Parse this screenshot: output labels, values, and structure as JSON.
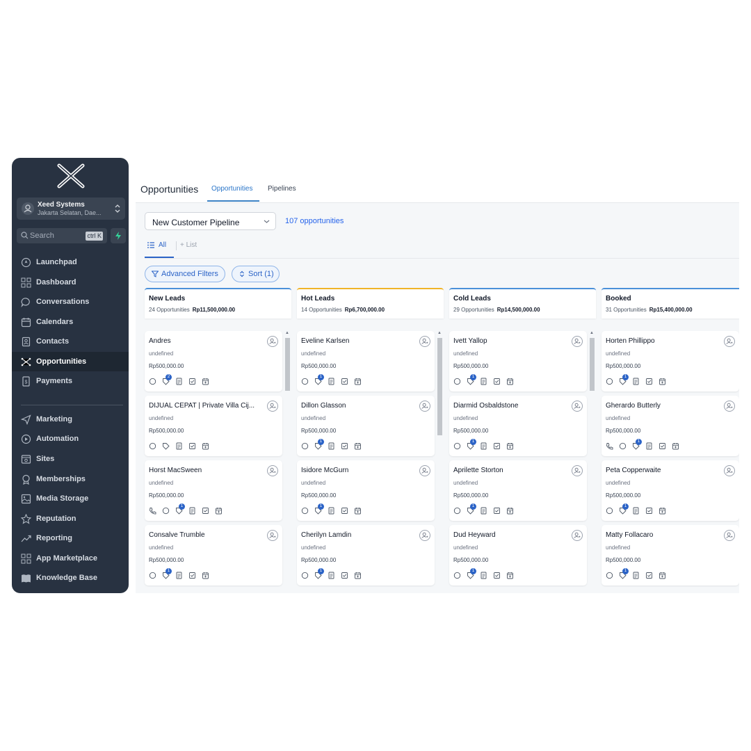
{
  "sidebar": {
    "account_name": "Xeed Systems",
    "account_location": "Jakarta Selatan, Dae...",
    "search_placeholder": "Search",
    "search_shortcut": "ctrl K",
    "items": [
      {
        "label": "Launchpad",
        "icon": "rocket-icon"
      },
      {
        "label": "Dashboard",
        "icon": "grid-icon"
      },
      {
        "label": "Conversations",
        "icon": "chat-icon"
      },
      {
        "label": "Calendars",
        "icon": "calendar-icon"
      },
      {
        "label": "Contacts",
        "icon": "contacts-icon"
      },
      {
        "label": "Opportunities",
        "icon": "opportunities-icon",
        "active": true
      },
      {
        "label": "Payments",
        "icon": "payments-icon"
      },
      {
        "label": "Marketing",
        "icon": "send-icon"
      },
      {
        "label": "Automation",
        "icon": "automation-icon"
      },
      {
        "label": "Sites",
        "icon": "sites-icon"
      },
      {
        "label": "Memberships",
        "icon": "badge-icon"
      },
      {
        "label": "Media Storage",
        "icon": "image-icon"
      },
      {
        "label": "Reputation",
        "icon": "star-icon"
      },
      {
        "label": "Reporting",
        "icon": "trend-icon"
      },
      {
        "label": "App Marketplace",
        "icon": "apps-icon"
      },
      {
        "label": "Knowledge Base",
        "icon": "book-icon"
      }
    ]
  },
  "header": {
    "title": "Opportunities",
    "tabs": [
      "Opportunities",
      "Pipelines"
    ]
  },
  "toolbar": {
    "pipeline": "New Customer Pipeline",
    "opportunity_count": "107 opportunities",
    "view_all": "All",
    "view_list": "+ List",
    "advanced_filters": "Advanced Filters",
    "sort": "Sort (1)"
  },
  "columns": [
    {
      "title": "New Leads",
      "count": "24 Opportunities",
      "total": "Rp11,500,000.00",
      "cards": [
        {
          "name": "Andres",
          "source": "undefined",
          "value": "Rp500,000.00",
          "badge": "2",
          "phone": false
        },
        {
          "name": "DIJUAL CEPAT | Private Villa Cij...",
          "source": "undefined",
          "value": "Rp500,000.00",
          "badge": "",
          "phone": false
        },
        {
          "name": "Horst MacSween",
          "source": "undefined",
          "value": "Rp500,000.00",
          "badge": "1",
          "phone": true
        },
        {
          "name": "Consalve Trumble",
          "source": "undefined",
          "value": "Rp500,000.00",
          "badge": "1",
          "phone": false
        }
      ]
    },
    {
      "title": "Hot Leads",
      "count": "14 Opportunities",
      "total": "Rp6,700,000.00",
      "cards": [
        {
          "name": "Eveline Karlsen",
          "source": "undefined",
          "value": "Rp500,000.00",
          "badge": "1",
          "phone": false
        },
        {
          "name": "Dillon Glasson",
          "source": "undefined",
          "value": "Rp500,000.00",
          "badge": "1",
          "phone": false
        },
        {
          "name": "Isidore McGurn",
          "source": "undefined",
          "value": "Rp500,000.00",
          "badge": "1",
          "phone": false
        },
        {
          "name": "Cherilyn Lamdin",
          "source": "undefined",
          "value": "Rp500,000.00",
          "badge": "1",
          "phone": false
        }
      ]
    },
    {
      "title": "Cold Leads",
      "count": "29 Opportunities",
      "total": "Rp14,500,000.00",
      "cards": [
        {
          "name": "Ivett Yallop",
          "source": "undefined",
          "value": "Rp500,000.00",
          "badge": "1",
          "phone": false
        },
        {
          "name": "Diarmid Osbaldstone",
          "source": "undefined",
          "value": "Rp500,000.00",
          "badge": "1",
          "phone": false
        },
        {
          "name": "Aprilette Storton",
          "source": "undefined",
          "value": "Rp500,000.00",
          "badge": "1",
          "phone": false
        },
        {
          "name": "Dud Heyward",
          "source": "undefined",
          "value": "Rp500,000.00",
          "badge": "1",
          "phone": false
        }
      ]
    },
    {
      "title": "Booked",
      "count": "31 Opportunities",
      "total": "Rp15,400,000.00",
      "cards": [
        {
          "name": "Horten Phillippo",
          "source": "undefined",
          "value": "Rp500,000.00",
          "badge": "1",
          "phone": false
        },
        {
          "name": "Gherardo Butterly",
          "source": "undefined",
          "value": "Rp500,000.00",
          "badge": "1",
          "phone": true
        },
        {
          "name": "Peta Copperwaite",
          "source": "undefined",
          "value": "Rp500,000.00",
          "badge": "1",
          "phone": false
        },
        {
          "name": "Matty Follacaro",
          "source": "undefined",
          "value": "Rp500,000.00",
          "badge": "1",
          "phone": false
        }
      ]
    }
  ],
  "colors": {
    "sidebar_bg": "#283241",
    "accent": "#2b63c7",
    "new_leads": "#4a90d9",
    "hot_leads": "#f0b429",
    "cold_leads": "#4a90d9",
    "booked": "#4a90d9"
  }
}
